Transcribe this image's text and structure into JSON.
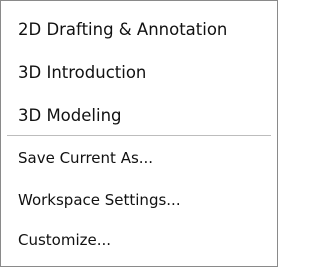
{
  "menu": {
    "workspaces": [
      {
        "label": "2D Drafting & Annotation"
      },
      {
        "label": "3D Introduction"
      },
      {
        "label": "3D Modeling"
      }
    ],
    "actions": [
      {
        "label": "Save Current As..."
      },
      {
        "label": "Workspace Settings..."
      },
      {
        "label": "Customize..."
      }
    ]
  }
}
